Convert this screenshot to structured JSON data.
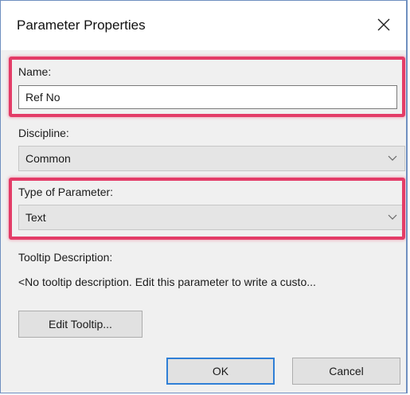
{
  "dialog": {
    "title": "Parameter Properties",
    "close_icon": "close-icon"
  },
  "name": {
    "label": "Name:",
    "value": "Ref No"
  },
  "discipline": {
    "label": "Discipline:",
    "selected": "Common"
  },
  "type_of_parameter": {
    "label": "Type of Parameter:",
    "selected": "Text"
  },
  "tooltip": {
    "label": "Tooltip Description:",
    "text": "<No tooltip description. Edit this parameter to write a custo...",
    "edit_button": "Edit Tooltip..."
  },
  "buttons": {
    "ok": "OK",
    "cancel": "Cancel"
  },
  "colors": {
    "highlight": "#e33c67",
    "default_button_border": "#2f7fd6",
    "window_border": "#6f8fc0"
  }
}
